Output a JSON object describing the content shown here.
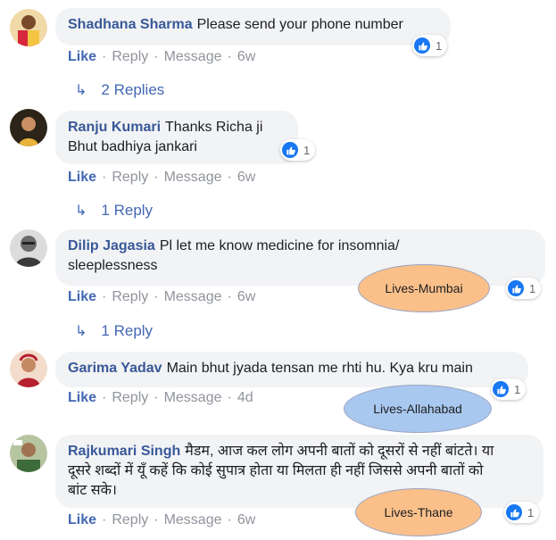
{
  "comments": [
    {
      "author": "Shadhana Sharma",
      "text": "Please send your phone number",
      "like": "Like",
      "reply": "Reply",
      "message": "Message",
      "time": "6w",
      "reaction_count": "1",
      "replies_label": "2 Replies"
    },
    {
      "author": "Ranju Kumari",
      "text_line1": "Thanks Richa ji",
      "text_line2": "Bhut badhiya jankari",
      "like": "Like",
      "reply": "Reply",
      "message": "Message",
      "time": "6w",
      "reaction_count": "1",
      "replies_label": "1 Reply"
    },
    {
      "author": "Dilip Jagasia",
      "text_line1": "Pl let me know medicine for insomnia/",
      "text_line2": "sleeplessness",
      "like": "Like",
      "reply": "Reply",
      "message": "Message",
      "time": "6w",
      "reaction_count": "1",
      "replies_label": "1 Reply",
      "annotation": "Lives-Mumbai"
    },
    {
      "author": "Garima Yadav",
      "text": "Main bhut jyada tensan me rhti hu. Kya kru main",
      "like": "Like",
      "reply": "Reply",
      "message": "Message",
      "time": "4d",
      "reaction_count": "1",
      "annotation": "Lives-Allahabad"
    },
    {
      "author": "Rajkumari Singh",
      "text_line1": "मैडम, आज कल लोग अपनी बातों को दूसरों से नहीं बांटते। या",
      "text_line2": "दूसरे शब्दों में यूँ कहें कि कोई सुपात्र होता या मिलता ही नहीं जिससे अपनी बातों को",
      "text_line3": "बांट सके।",
      "like": "Like",
      "reply": "Reply",
      "message": "Message",
      "time": "6w",
      "reaction_count": "1",
      "annotation": "Lives-Thane"
    }
  ],
  "colors": {
    "author": "#385898",
    "like": "#4267b2",
    "meta": "#90949c",
    "bubble": "#f2f3f5",
    "reaction": "#1877f2",
    "ellipse_orange": "#fbc08a",
    "ellipse_blue": "#a9c8ef"
  },
  "icons": {
    "reaction": "thumbs-up-icon",
    "reply_arrow": "reply-arrow-icon"
  }
}
